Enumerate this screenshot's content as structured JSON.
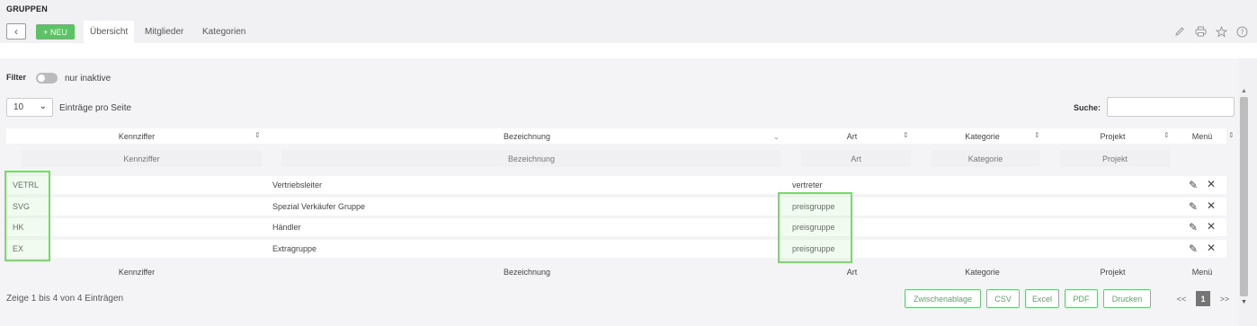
{
  "app": {
    "title": "GRUPPEN"
  },
  "toolbar": {
    "back": "‹",
    "new_label": "+ NEU"
  },
  "tabs": [
    {
      "label": "Übersicht"
    },
    {
      "label": "Mitglieder"
    },
    {
      "label": "Kategorien"
    }
  ],
  "header_icons": [
    "pencil-icon",
    "print-icon",
    "star-icon",
    "help-icon"
  ],
  "filter": {
    "label": "Filter",
    "toggle_label": "nur inaktive"
  },
  "page_size": {
    "value": "10",
    "label": "Einträge pro Seite"
  },
  "search": {
    "label": "Suche:",
    "value": ""
  },
  "table": {
    "columns": [
      "Kennziffer",
      "Bezeichnung",
      "Art",
      "Kategorie",
      "Projekt",
      "Menü"
    ],
    "filter_placeholders": [
      "Kennziffer",
      "Bezeichnung",
      "Art",
      "Kategorie",
      "Projekt"
    ],
    "rows": [
      {
        "kennziffer": "VETRL",
        "bezeichnung": "Vertriebsleiter",
        "art": "vertreter",
        "kategorie": "",
        "projekt": ""
      },
      {
        "kennziffer": "SVG",
        "bezeichnung": "Spezial Verkäufer Gruppe",
        "art": "preisgruppe",
        "kategorie": "",
        "projekt": ""
      },
      {
        "kennziffer": "HK",
        "bezeichnung": "Händler",
        "art": "preisgruppe",
        "kategorie": "",
        "projekt": ""
      },
      {
        "kennziffer": "EX",
        "bezeichnung": "Extragruppe",
        "art": "preisgruppe",
        "kategorie": "",
        "projekt": ""
      }
    ],
    "footer": [
      "Kennziffer",
      "Bezeichnung",
      "Art",
      "Kategorie",
      "Projekt",
      "Menü"
    ]
  },
  "info": "Zeige 1 bis 4 von 4 Einträgen",
  "export_buttons": [
    "Zwischenablage",
    "CSV",
    "Excel",
    "PDF",
    "Drucken"
  ],
  "pagination": {
    "first": "<<",
    "current": "1",
    "last": ">>"
  },
  "colors": {
    "accent": "#5cc265",
    "highlight": "#7ad86f"
  }
}
